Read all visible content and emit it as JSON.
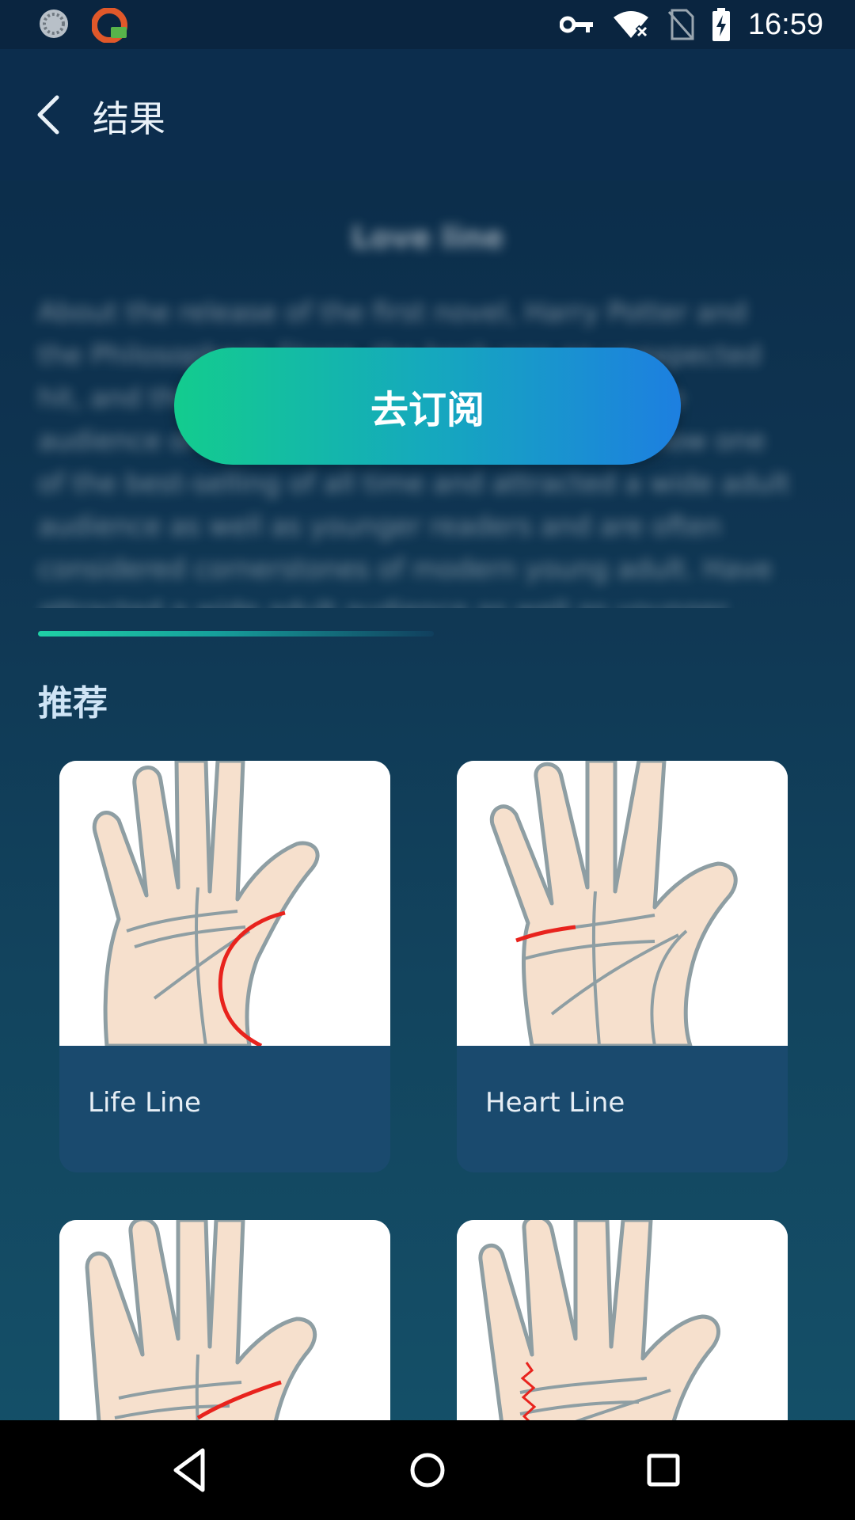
{
  "status_bar": {
    "time": "16:59",
    "left_icons": [
      "loading-icon",
      "vpn-app-icon"
    ],
    "right_icons": [
      "key-icon",
      "wifi-off-icon",
      "no-sim-icon",
      "battery-charging-icon"
    ]
  },
  "app_bar": {
    "title": "结果",
    "back_icon": "chevron-left-icon"
  },
  "locked_content": {
    "title": "Love line",
    "text": "About the release of the first novel, Harry Potter and the Philosopher's Stone, the book was an unexpected hit, and the novels found readers among a wide audience of adults and children; the series is now one of the best-selling of all time and attracted a wide adult audience as well as younger readers and are often considered cornerstones of modern young adult. Have attracted a wide adult audience as well as younger readers and are."
  },
  "subscribe_button": "去订阅",
  "recommend": {
    "title": "推荐",
    "cards": [
      {
        "label": "Life Line"
      },
      {
        "label": "Heart Line"
      },
      {
        "label": ""
      },
      {
        "label": ""
      }
    ]
  },
  "nav_bar": {
    "icons": [
      "back-triangle-icon",
      "home-circle-icon",
      "recents-square-icon"
    ]
  },
  "colors": {
    "accent_start": "#13cc8e",
    "accent_end": "#1d7fe0",
    "palm_line": "#e8231d"
  }
}
